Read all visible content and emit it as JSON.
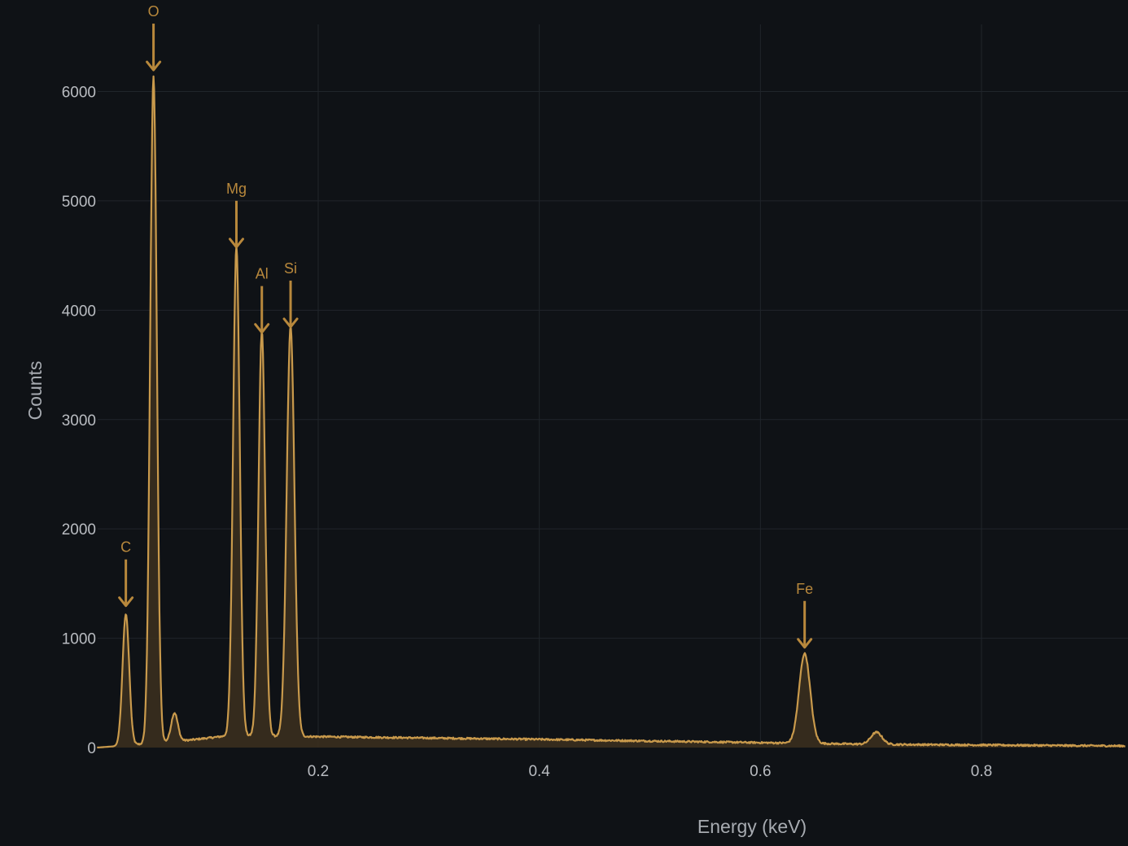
{
  "chart_data": {
    "type": "area",
    "xlabel": "Energy (keV)",
    "ylabel": "Counts",
    "xlim": [
      0.0,
      0.93
    ],
    "ylim": [
      0,
      6600
    ],
    "x_ticks": [
      0.2,
      0.4,
      0.6,
      0.8
    ],
    "y_ticks": [
      0,
      1000,
      2000,
      3000,
      4000,
      5000,
      6000
    ],
    "grid": true,
    "line_color": "#c99a4c",
    "fill_color": "#3a2f1e",
    "background": "#0f1216",
    "grid_color": "#20252b",
    "peaks": [
      {
        "element": "C",
        "energy": 0.026,
        "counts": 1200,
        "width": 0.003
      },
      {
        "element": "O",
        "energy": 0.051,
        "counts": 6100,
        "width": 0.003
      },
      {
        "element": "",
        "energy": 0.07,
        "counts": 260,
        "width": 0.003
      },
      {
        "element": "Mg",
        "energy": 0.126,
        "counts": 4480,
        "width": 0.003
      },
      {
        "element": "Al",
        "energy": 0.149,
        "counts": 3700,
        "width": 0.003
      },
      {
        "element": "Si",
        "energy": 0.175,
        "counts": 3750,
        "width": 0.0035
      },
      {
        "element": "Fe",
        "energy": 0.64,
        "counts": 820,
        "width": 0.005
      },
      {
        "element": "",
        "energy": 0.705,
        "counts": 110,
        "width": 0.005
      }
    ],
    "baseline": [
      [
        0.0,
        0
      ],
      [
        0.02,
        15
      ],
      [
        0.085,
        70
      ],
      [
        0.12,
        110
      ],
      [
        0.2,
        100
      ],
      [
        0.4,
        75
      ],
      [
        0.6,
        45
      ],
      [
        0.7,
        30
      ],
      [
        0.93,
        15
      ]
    ],
    "annotations": [
      {
        "label": "C",
        "energy": 0.026,
        "counts": 1200
      },
      {
        "label": "O",
        "energy": 0.051,
        "counts": 6100
      },
      {
        "label": "Mg",
        "energy": 0.126,
        "counts": 4480
      },
      {
        "label": "Al",
        "energy": 0.149,
        "counts": 3700
      },
      {
        "label": "Si",
        "energy": 0.175,
        "counts": 3750
      },
      {
        "label": "Fe",
        "energy": 0.64,
        "counts": 820
      }
    ]
  }
}
